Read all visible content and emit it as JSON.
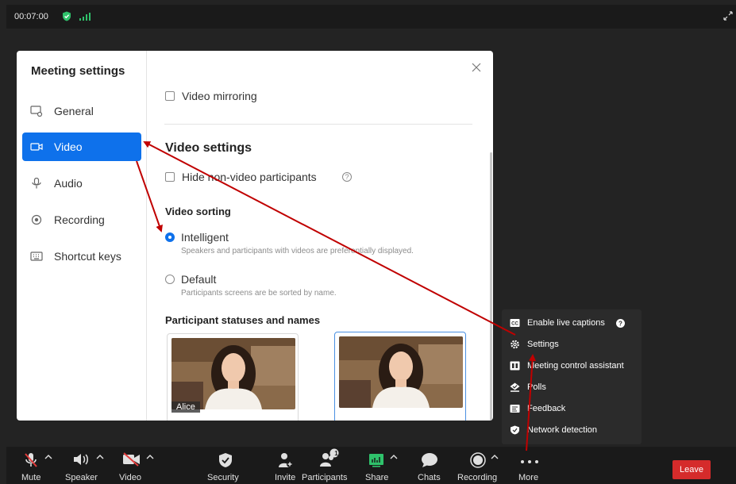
{
  "topbar": {
    "timer": "00:07:00"
  },
  "modal": {
    "title": "Meeting settings",
    "nav": [
      {
        "label": "General",
        "icon": "general-icon"
      },
      {
        "label": "Video",
        "icon": "video-icon",
        "active": true
      },
      {
        "label": "Audio",
        "icon": "microphone-icon"
      },
      {
        "label": "Recording",
        "icon": "record-icon"
      },
      {
        "label": "Shortcut keys",
        "icon": "keyboard-icon"
      }
    ],
    "video_mirroring": "Video mirroring",
    "video_settings_title": "Video settings",
    "hide_non_video": "Hide non-video participants",
    "video_sorting_title": "Video sorting",
    "intelligent_label": "Intelligent",
    "intelligent_desc": "Speakers and participants with videos are preferentially displayed.",
    "default_label": "Default",
    "default_desc": "Participants screens are be sorted by name.",
    "statuses_title": "Participant statuses and names",
    "card_name": "Alice"
  },
  "more_menu": {
    "items": [
      {
        "label": "Enable live captions",
        "icon": "cc-icon",
        "help": true
      },
      {
        "label": "Settings",
        "icon": "gear-icon"
      },
      {
        "label": "Meeting control assistant",
        "icon": "assistant-icon"
      },
      {
        "label": "Polls",
        "icon": "polls-icon"
      },
      {
        "label": "Feedback",
        "icon": "feedback-icon"
      },
      {
        "label": "Network detection",
        "icon": "network-icon"
      }
    ]
  },
  "toolbar": {
    "mute": "Mute",
    "speaker": "Speaker",
    "video": "Video",
    "security": "Security",
    "invite": "Invite",
    "participants": "Participants",
    "participants_count": "1",
    "share": "Share",
    "chats": "Chats",
    "recording": "Recording",
    "more": "More",
    "leave": "Leave"
  },
  "colors": {
    "accent": "#0e71eb",
    "leave": "#d52b2b",
    "arrow": "#c00000"
  }
}
